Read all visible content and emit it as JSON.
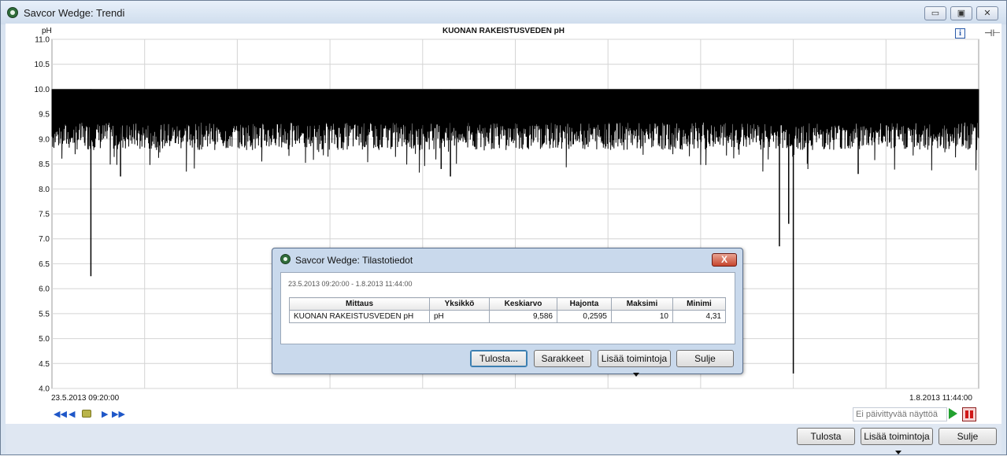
{
  "window": {
    "title": "Savcor Wedge: Trendi",
    "minimize_label": "▭",
    "restore_label": "▣",
    "close_label": "✕"
  },
  "chart": {
    "title": "KUONAN RAKEISTUSVEDEN pH",
    "unit": "pH",
    "info_label": "i",
    "pin_label": "⊣⊢",
    "x_start_label": "23.5.2013 09:20:00",
    "x_end_label": "1.8.2013 11:44:00"
  },
  "chart_data": {
    "type": "line",
    "title": "KUONAN RAKEISTUSVEDEN pH",
    "ylabel": "pH",
    "ylim": [
      4.0,
      11.0
    ],
    "yticks": [
      "11.0",
      "10.5",
      "10.0",
      "9.5",
      "9.0",
      "8.5",
      "8.0",
      "7.5",
      "7.0",
      "6.5",
      "6.0",
      "5.5",
      "5.0",
      "4.5",
      "4.0"
    ],
    "x_range": [
      "23.5.2013 09:20:00",
      "1.8.2013 11:44:00"
    ],
    "grid": true,
    "series": [
      {
        "values_upper": 10.0,
        "dips": [
          {
            "x": 0.042,
            "y": 6.25
          },
          {
            "x": 0.074,
            "y": 8.25
          },
          {
            "x": 0.42,
            "y": 8.4
          },
          {
            "x": 0.43,
            "y": 8.25
          },
          {
            "x": 0.785,
            "y": 6.85
          },
          {
            "x": 0.795,
            "y": 7.3
          },
          {
            "x": 0.8,
            "y": 4.3
          },
          {
            "x": 0.87,
            "y": 8.3
          }
        ],
        "typical_low": 9.0
      }
    ]
  },
  "controls": {
    "refresh_placeholder": "Ei päivittyvää näyttöä"
  },
  "bottom": {
    "print_label": "Tulosta",
    "more_label": "Lisää toimintoja",
    "close_label": "Sulje"
  },
  "dialog": {
    "title": "Savcor Wedge: Tilastotiedot",
    "close_label": "X",
    "period": "23.5.2013 09:20:00 - 1.8.2013 11:44:00",
    "headers": [
      "Mittaus",
      "Yksikkö",
      "Keskiarvo",
      "Hajonta",
      "Maksimi",
      "Minimi"
    ],
    "rows": [
      [
        "KUONAN RAKEISTUSVEDEN pH",
        "pH",
        "9,586",
        "0,2595",
        "10",
        "4,31"
      ]
    ],
    "print_label": "Tulosta...",
    "columns_label": "Sarakkeet",
    "more_label": "Lisää toimintoja",
    "close_button_label": "Sulje"
  }
}
